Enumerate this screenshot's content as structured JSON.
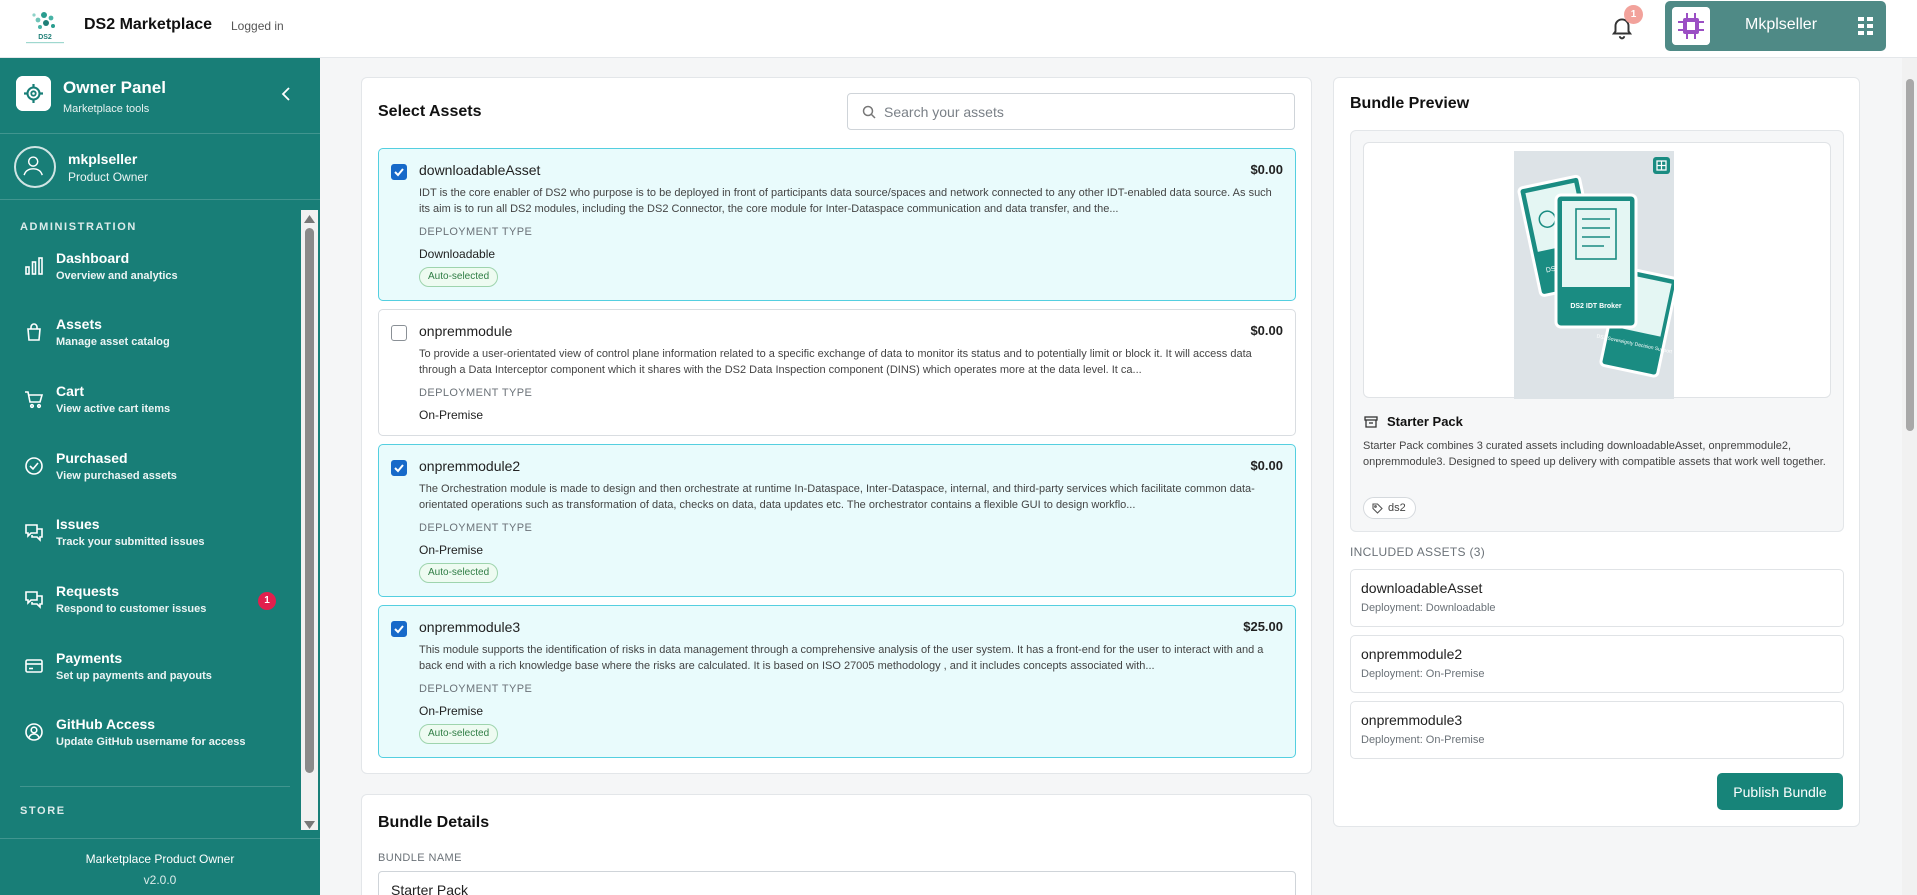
{
  "app": {
    "title": "DS2 Marketplace",
    "status": "Logged in"
  },
  "header": {
    "notification_count": "1",
    "user_name": "Mkplseller"
  },
  "colors": {
    "primary": "#187e77",
    "accent": "#1769c9",
    "badge": "#e21f4d",
    "selected_bg": "#e9fbfc"
  },
  "sidebar": {
    "panel_title": "Owner Panel",
    "panel_subtitle": "Marketplace tools",
    "user": {
      "name": "mkplseller",
      "role": "Product Owner"
    },
    "sections": {
      "administration": "ADMINISTRATION",
      "store": "STORE"
    },
    "items": [
      {
        "title": "Dashboard",
        "subtitle": "Overview and analytics",
        "icon": "bar-chart-icon"
      },
      {
        "title": "Assets",
        "subtitle": "Manage asset catalog",
        "icon": "shopping-bag-icon"
      },
      {
        "title": "Cart",
        "subtitle": "View active cart items",
        "icon": "cart-icon"
      },
      {
        "title": "Purchased",
        "subtitle": "View purchased assets",
        "icon": "check-circle-icon"
      },
      {
        "title": "Issues",
        "subtitle": "Track your submitted issues",
        "icon": "chat-icon"
      },
      {
        "title": "Requests",
        "subtitle": "Respond to customer issues",
        "icon": "chat-icon",
        "badge": "1"
      },
      {
        "title": "Payments",
        "subtitle": "Set up payments and payouts",
        "icon": "credit-card-icon"
      },
      {
        "title": "GitHub Access",
        "subtitle": "Update GitHub username for access",
        "icon": "user-circle-icon"
      }
    ],
    "footer": {
      "title": "Marketplace Product Owner",
      "version": "v2.0.0"
    }
  },
  "select_assets": {
    "title": "Select Assets",
    "search_placeholder": "Search your assets",
    "deployment_label": "DEPLOYMENT TYPE",
    "auto_label": "Auto-selected",
    "assets": [
      {
        "name": "downloadableAsset",
        "price": "$0.00",
        "selected": true,
        "auto": true,
        "deployment": "Downloadable",
        "description": "IDT is the core enabler of DS2 who purpose is to be deployed in front of participants data source/spaces and network connected to any other IDT-enabled data source. As such its aim is to run all DS2 modules, including the DS2 Connector, the core module for Inter-Dataspace communication and data transfer, and the..."
      },
      {
        "name": "onpremmodule",
        "price": "$0.00",
        "selected": false,
        "auto": false,
        "deployment": "On-Premise",
        "description": "To provide a user-orientated view of control plane information related to a specific exchange of data to monitor its status and to potentially limit or block it. It will access data through a Data Interceptor component which it shares with the DS2 Data Inspection component (DINS) which operates more at the data level. It ca..."
      },
      {
        "name": "onpremmodule2",
        "price": "$0.00",
        "selected": true,
        "auto": true,
        "deployment": "On-Premise",
        "description": "The Orchestration module is made to design and then orchestrate at runtime In-Dataspace, Inter-Dataspace, internal, and third-party services which facilitate common data-orientated operations such as transformation of data, checks on data, data updates etc. The orchestrator contains a flexible GUI to design workflo..."
      },
      {
        "name": "onpremmodule3",
        "price": "$25.00",
        "selected": true,
        "auto": true,
        "deployment": "On-Premise",
        "description": "This module supports the identification of risks in data management through a comprehensive analysis of the user system. It has a front-end for the user to interact with and a back end with a rich knowledge base where the risks are calculated. It is based on ISO 27005 methodology , and it includes concepts associated with..."
      }
    ]
  },
  "bundle_details": {
    "title": "Bundle Details",
    "name_label": "BUNDLE NAME",
    "name_value": "Starter Pack"
  },
  "preview": {
    "title": "Bundle Preview",
    "image_labels": {
      "main": "DS2 IDT Broker",
      "side": "DS2 Sovereignty Decision Support",
      "back": "DS2"
    },
    "pack_name": "Starter Pack",
    "pack_description": "Starter Pack combines 3 curated assets including downloadableAsset, onpremmodule2, onpremmodule3. Designed to speed up delivery with compatible assets that work well together.",
    "tag": "ds2",
    "included_label": "INCLUDED ASSETS (3)",
    "included": [
      {
        "name": "downloadableAsset",
        "deployment": "Deployment: Downloadable"
      },
      {
        "name": "onpremmodule2",
        "deployment": "Deployment: On-Premise"
      },
      {
        "name": "onpremmodule3",
        "deployment": "Deployment: On-Premise"
      }
    ],
    "publish_label": "Publish Bundle"
  }
}
